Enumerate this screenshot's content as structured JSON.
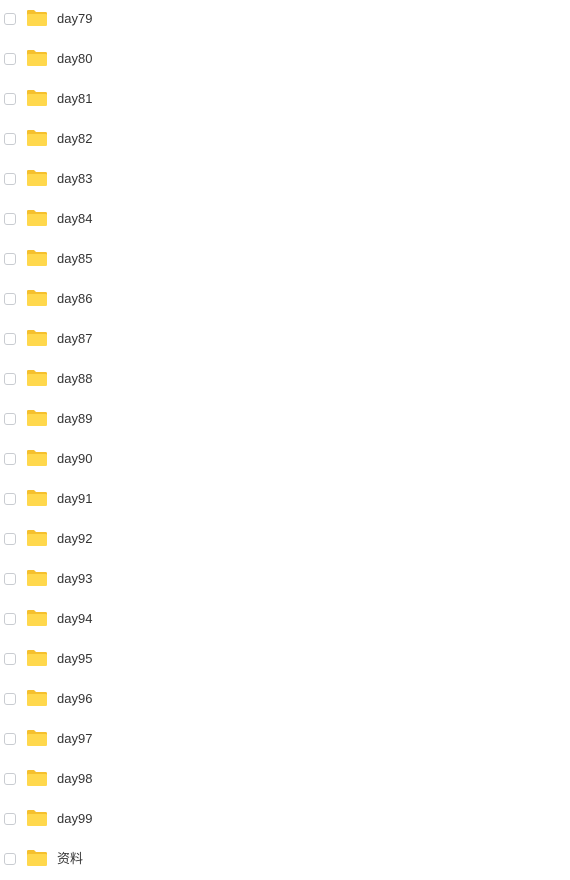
{
  "folders": [
    {
      "name": "day79",
      "icon": "folder-icon"
    },
    {
      "name": "day80",
      "icon": "folder-icon"
    },
    {
      "name": "day81",
      "icon": "folder-icon"
    },
    {
      "name": "day82",
      "icon": "folder-icon"
    },
    {
      "name": "day83",
      "icon": "folder-icon"
    },
    {
      "name": "day84",
      "icon": "folder-icon"
    },
    {
      "name": "day85",
      "icon": "folder-icon"
    },
    {
      "name": "day86",
      "icon": "folder-icon"
    },
    {
      "name": "day87",
      "icon": "folder-icon"
    },
    {
      "name": "day88",
      "icon": "folder-icon"
    },
    {
      "name": "day89",
      "icon": "folder-icon"
    },
    {
      "name": "day90",
      "icon": "folder-icon"
    },
    {
      "name": "day91",
      "icon": "folder-icon"
    },
    {
      "name": "day92",
      "icon": "folder-icon"
    },
    {
      "name": "day93",
      "icon": "folder-icon"
    },
    {
      "name": "day94",
      "icon": "folder-icon"
    },
    {
      "name": "day95",
      "icon": "folder-icon"
    },
    {
      "name": "day96",
      "icon": "folder-icon"
    },
    {
      "name": "day97",
      "icon": "folder-icon"
    },
    {
      "name": "day98",
      "icon": "folder-icon"
    },
    {
      "name": "day99",
      "icon": "folder-icon"
    },
    {
      "name": "资料",
      "icon": "folder-icon"
    }
  ],
  "colors": {
    "folder_body": "#FFD84D",
    "folder_tab": "#F5C02E",
    "checkbox_border": "#C9CCD1",
    "text": "#333333"
  }
}
